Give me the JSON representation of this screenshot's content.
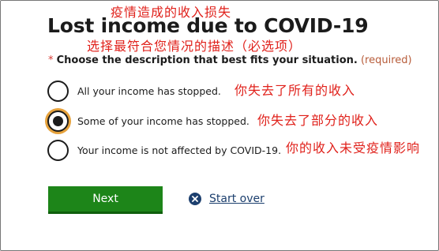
{
  "annotations": {
    "title_translation": "疫情造成的收入损失",
    "question_translation": "选择最符合您情况的描述（必选项）",
    "option_translations": [
      "你失去了所有的收入",
      "你失去了部分的收入",
      "你的收入未受疫情影响"
    ]
  },
  "page": {
    "title": "Lost income due to COVID-19"
  },
  "question": {
    "required_marker": "*",
    "text": "Choose the description that best fits your situation.",
    "required_label": "(required)"
  },
  "options": [
    {
      "label": "All your income has stopped.",
      "selected": false
    },
    {
      "label": "Some of your income has stopped.",
      "selected": true
    },
    {
      "label": "Your income is not affected by COVID-19.",
      "selected": false
    }
  ],
  "actions": {
    "next_label": "Next",
    "start_over_label": "Start over",
    "start_over_icon": "close-circle-icon"
  },
  "colors": {
    "primary_green": "#1d8519",
    "link_blue": "#1c3f6e",
    "focus_orange": "#e6a23c",
    "annotation_red": "#e0211b"
  }
}
